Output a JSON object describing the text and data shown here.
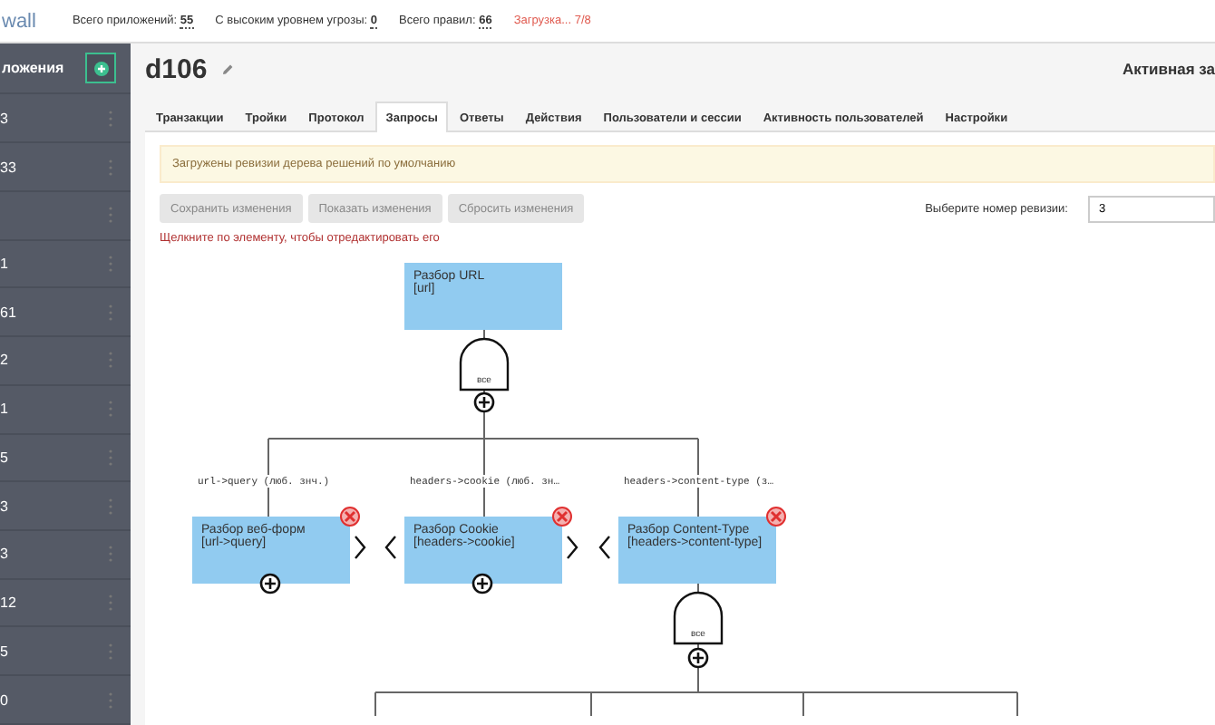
{
  "topbar": {
    "logo": "wall",
    "stats": [
      {
        "label": "Всего приложений:",
        "value": "55"
      },
      {
        "label": "С высоким уровнем угрозы:",
        "value": "0"
      },
      {
        "label": "Всего правил:",
        "value": "66"
      }
    ],
    "loading": "Загрузка... 7/8"
  },
  "sidebar": {
    "title": "ложения",
    "items": [
      {
        "kind": "text",
        "label": "3"
      },
      {
        "kind": "text",
        "label": "33"
      },
      {
        "kind": "blank"
      },
      {
        "kind": "text",
        "label": "1"
      },
      {
        "kind": "text",
        "label": "61"
      },
      {
        "kind": "text",
        "label": "2"
      },
      {
        "kind": "text",
        "label": "1"
      },
      {
        "kind": "text",
        "label": "5"
      },
      {
        "kind": "text",
        "label": "3"
      },
      {
        "kind": "text",
        "label": "3"
      },
      {
        "kind": "text",
        "label": "12"
      },
      {
        "kind": "text",
        "label": "5"
      },
      {
        "kind": "text",
        "label": "0"
      }
    ]
  },
  "page": {
    "title": "d106",
    "status": "Активная за",
    "tabs": [
      {
        "label": "Транзакции",
        "selected": false
      },
      {
        "label": "Тройки",
        "selected": false
      },
      {
        "label": "Протокол",
        "selected": false
      },
      {
        "label": "Запросы",
        "selected": true
      },
      {
        "label": "Ответы",
        "selected": false
      },
      {
        "label": "Действия",
        "selected": false
      },
      {
        "label": "Пользователи и сессии",
        "selected": false
      },
      {
        "label": "Активность пользователей",
        "selected": false
      },
      {
        "label": "Настройки",
        "selected": false
      }
    ],
    "alert": "Загружены ревизии дерева решений по умолчанию",
    "buttons": [
      {
        "label": "Сохранить изменения",
        "disabled": true
      },
      {
        "label": "Показать изменения",
        "disabled": true
      },
      {
        "label": "Сбросить изменения",
        "disabled": true
      }
    ],
    "revision": {
      "label": "Выберите номер ревизии:",
      "value": "3"
    },
    "hint": "Щелкните по элементу, чтобы отредактировать его"
  },
  "diagram": {
    "root": {
      "title": "Разбор URL",
      "path": "[url]",
      "gate": "все"
    },
    "branches": [
      {
        "edge_label": "url->query (люб. знч.)",
        "title": "Разбор веб-форм",
        "path": "[url->query]"
      },
      {
        "edge_label": "headers->cookie (люб. зн…",
        "title": "Разбор Cookie",
        "path": "[headers->cookie]"
      },
      {
        "edge_label": "headers->content-type (з…",
        "title": "Разбор Content-Type",
        "path": "[headers->content-type]",
        "gate": "все"
      }
    ]
  }
}
